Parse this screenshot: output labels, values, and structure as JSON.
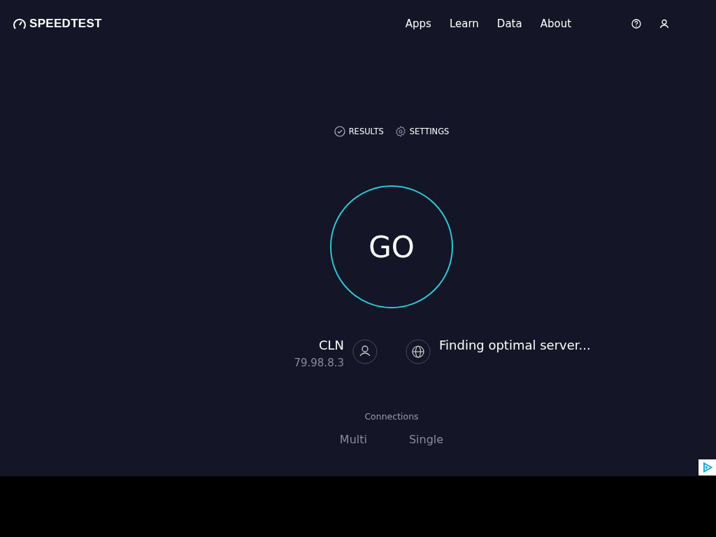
{
  "header": {
    "logo": "SPEEDTEST",
    "nav": [
      "Apps",
      "Learn",
      "Data",
      "About"
    ]
  },
  "links": [
    {
      "kind": "results",
      "label": "RESULTS"
    },
    {
      "kind": "settings",
      "label": "SETTINGS"
    }
  ],
  "go": "GO",
  "provider": {
    "name": "CLN",
    "ip": "79.98.8.3"
  },
  "server": {
    "status": "Finding optimal server..."
  },
  "connections": {
    "label": "Connections",
    "options": [
      "Multi",
      "Single"
    ]
  }
}
